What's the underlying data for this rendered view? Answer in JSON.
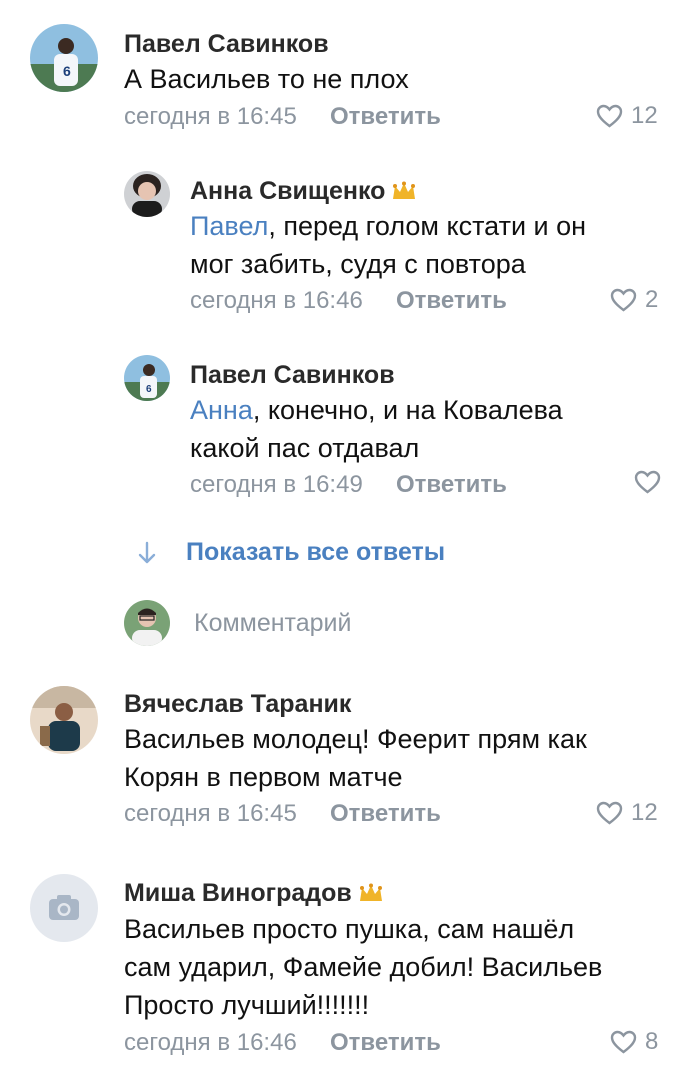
{
  "comments": [
    {
      "author": "Павел Савинков",
      "text": "А Васильев то не плох",
      "time": "сегодня в 16:45",
      "reply_label": "Ответить",
      "likes": "12"
    },
    {
      "author": "Анна Свищенко",
      "mention": "Павел",
      "text_line1": ", перед голом кстати и он",
      "text_line2": "мог забить, судя с повтора",
      "time": "сегодня в 16:46",
      "reply_label": "Ответить",
      "likes": "2"
    },
    {
      "author": "Павел Савинков",
      "mention": "Анна",
      "text_line1": ", конечно, и на Ковалева",
      "text_line2": "какой пас отдавал",
      "time": "сегодня в 16:49",
      "reply_label": "Ответить",
      "likes": ""
    },
    {
      "author": "Вячеслав Тараник",
      "text_line1": "Васильев молодец! Феерит прям как",
      "text_line2": "Корян в первом матче",
      "time": "сегодня в 16:45",
      "reply_label": "Ответить",
      "likes": "12"
    },
    {
      "author": "Миша Виноградов",
      "text_line1": "Васильев просто пушка, сам нашёл",
      "text_line2": "сам ударил, Фамейе добил! Васильев",
      "text_line3": "Просто лучший!!!!!!!",
      "time": "сегодня в 16:46",
      "reply_label": "Ответить",
      "likes": "8"
    }
  ],
  "show_all_replies": "Показать все ответы",
  "comment_input_placeholder": "Комментарий",
  "colors": {
    "link": "#4a80c0",
    "meta": "#8c959f",
    "crown": "#f0b429"
  },
  "icons": [
    "heart-icon",
    "crown-icon",
    "arrow-down-icon",
    "camera-icon"
  ]
}
